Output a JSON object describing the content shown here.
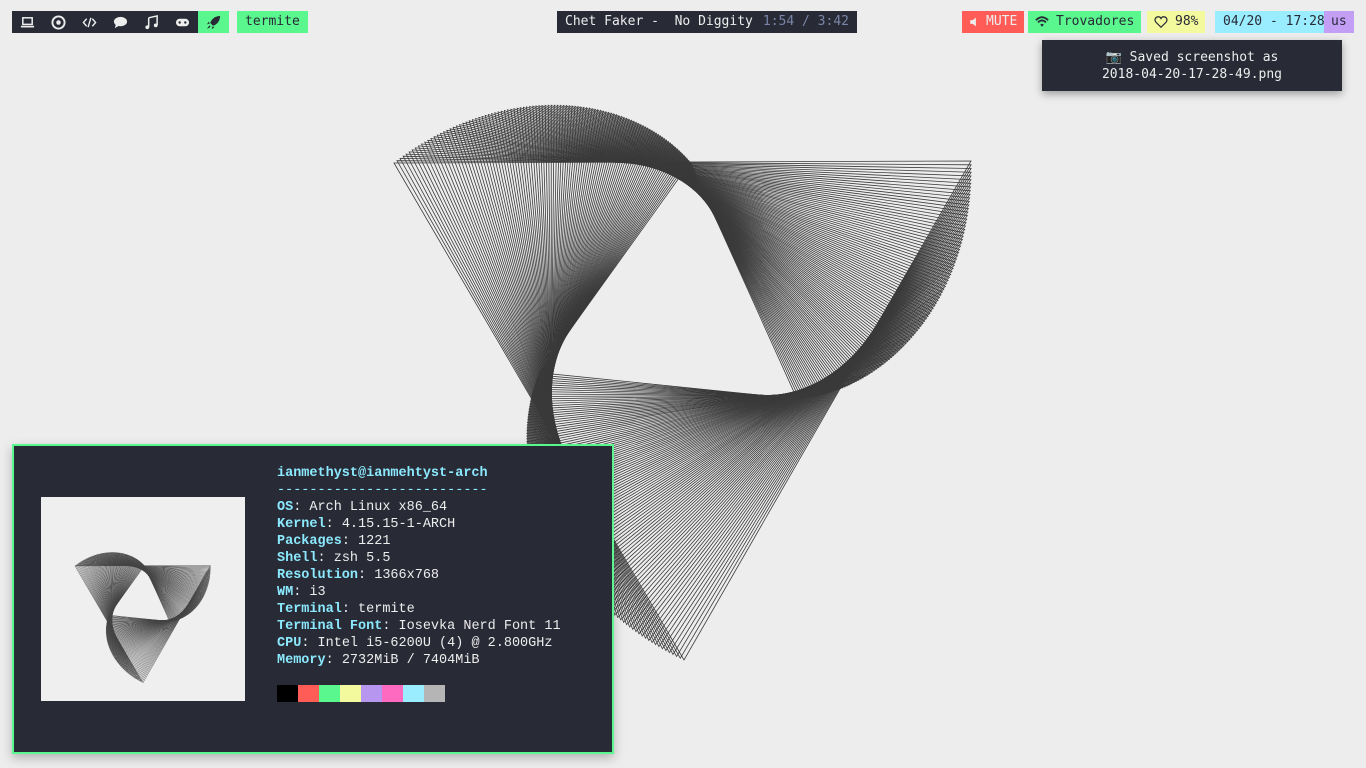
{
  "workspaces": [
    {
      "icon": "laptop-icon"
    },
    {
      "icon": "chrome-icon"
    },
    {
      "icon": "code-icon"
    },
    {
      "icon": "chat-icon"
    },
    {
      "icon": "music-note-icon"
    },
    {
      "icon": "gamepad-icon"
    },
    {
      "icon": "rocket-icon",
      "active": true
    }
  ],
  "window_title": "termite",
  "music": {
    "artist": "Chet Faker",
    "song": "No Diggity",
    "time": "1:54 / 3:42"
  },
  "status": {
    "volume": "MUTE",
    "wifi": "Trovadores",
    "battery": "98%",
    "datetime": "04/20 - 17:28",
    "layout": "us"
  },
  "notification": {
    "line1": "📷 Saved screenshot as",
    "line2": "2018-04-20-17-28-49.png"
  },
  "neofetch": {
    "header": "ianmethyst@ianmehtyst-arch",
    "separator": "--------------------------",
    "rows": [
      {
        "k": "OS",
        "v": "Arch Linux x86_64"
      },
      {
        "k": "Kernel",
        "v": "4.15.15-1-ARCH"
      },
      {
        "k": "Packages",
        "v": "1221"
      },
      {
        "k": "Shell",
        "v": "zsh 5.5"
      },
      {
        "k": "Resolution",
        "v": "1366x768"
      },
      {
        "k": "WM",
        "v": "i3"
      },
      {
        "k": "Terminal",
        "v": "termite"
      },
      {
        "k": "Terminal Font",
        "v": "Iosevka Nerd Font 11"
      },
      {
        "k": "CPU",
        "v": "Intel i5-6200U (4) @ 2.800GHz"
      },
      {
        "k": "Memory",
        "v": "2732MiB / 7404MiB"
      }
    ],
    "palette": [
      "#000000",
      "#ff5c57",
      "#5af78e",
      "#f3f99d",
      "#b796f0",
      "#ff6ac1",
      "#9aedfe",
      "#b5b5b5"
    ]
  },
  "colors": {
    "green": "#5af78e",
    "red": "#ff5c57",
    "yellow": "#f3f99d",
    "cyan": "#9aedfe",
    "purple": "#c39ef5",
    "dark": "#282a36"
  }
}
